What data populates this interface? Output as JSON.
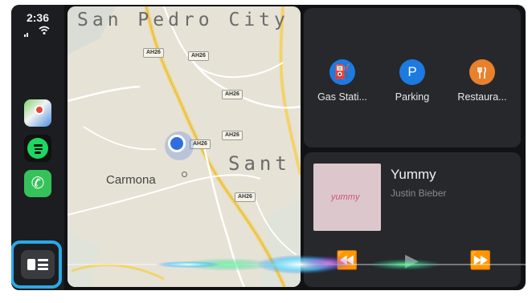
{
  "status_bar": {
    "time": "2:36",
    "wifi_icon": "wifi-icon",
    "signal_icon": "cellular-signal-icon"
  },
  "sidebar": {
    "apps": [
      {
        "name": "Maps",
        "icon": "maps-icon"
      },
      {
        "name": "Spotify",
        "icon": "spotify-icon"
      },
      {
        "name": "Phone",
        "icon": "phone-icon",
        "glyph": "✆"
      }
    ],
    "dashboard_button": {
      "icon": "dashboard-icon",
      "highlight_color": "#2ba9e6"
    }
  },
  "map": {
    "city_top": "San Pedro City",
    "city_right": "Sant",
    "town": "Carmona",
    "road_labels": [
      "AH26",
      "AH26",
      "AH26",
      "AH26",
      "AH26",
      "AH26"
    ],
    "location_color": "#2f6ee0"
  },
  "suggestions": [
    {
      "label": "Gas Stati...",
      "glyph": "⛽",
      "color": "#1c7ae0"
    },
    {
      "label": "Parking",
      "glyph": "P",
      "color": "#1c7ae0"
    },
    {
      "label": "Restaura...",
      "glyph": "🍴",
      "color": "#e8802c"
    }
  ],
  "now_playing": {
    "song": "Yummy",
    "artist": "Justin Bieber",
    "artwork_text": "yummy",
    "controls": {
      "previous": "⏪",
      "play": "▶",
      "next": "⏩"
    }
  },
  "colors": {
    "screen": "#111214",
    "panel": "#27282c",
    "sidebar": "#1c1d20",
    "map": "#e4e0d4"
  }
}
